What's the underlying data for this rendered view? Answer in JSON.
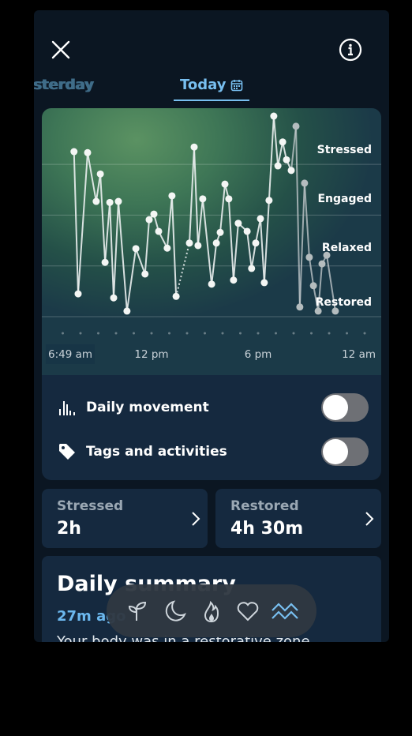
{
  "header": {
    "close_icon": "close-icon",
    "info_icon": "info-icon"
  },
  "tabs": [
    {
      "label": "sterday",
      "full_label": "Yesterday",
      "active": false
    },
    {
      "label": "Today",
      "active": true,
      "icon": "calendar-icon"
    }
  ],
  "colors": {
    "accent": "#78bff0",
    "stat_label": "#9aa7b3",
    "toggle_off": "#6e7075",
    "card": "#15293f",
    "background": "#0b1622"
  },
  "chart_data": {
    "type": "line",
    "title": "",
    "levels": [
      "Restored",
      "Relaxed",
      "Engaged",
      "Stressed"
    ],
    "x_tick_labels": [
      "6:49 am",
      "12 pm",
      "6 pm",
      "12 am"
    ],
    "xlim": [
      "06:49",
      "24:00"
    ],
    "ylim": [
      0,
      4
    ],
    "grid": true,
    "gap_between": [
      "13:23",
      "14:08"
    ],
    "faded_from": "20:08",
    "points": [
      [
        "07:38",
        3.25
      ],
      [
        "07:52",
        0.45
      ],
      [
        "08:24",
        3.23
      ],
      [
        "08:53",
        2.27
      ],
      [
        "09:07",
        2.81
      ],
      [
        "09:23",
        1.07
      ],
      [
        "09:39",
        2.25
      ],
      [
        "09:52",
        0.37
      ],
      [
        "10:08",
        2.27
      ],
      [
        "10:37",
        0.11
      ],
      [
        "11:07",
        1.34
      ],
      [
        "11:38",
        0.84
      ],
      [
        "11:52",
        1.91
      ],
      [
        "12:08",
        2.02
      ],
      [
        "12:24",
        1.68
      ],
      [
        "12:53",
        1.35
      ],
      [
        "13:09",
        2.38
      ],
      [
        "13:23",
        0.4
      ],
      [
        "14:08",
        1.45
      ],
      [
        "14:24",
        3.34
      ],
      [
        "14:37",
        1.4
      ],
      [
        "14:53",
        2.32
      ],
      [
        "15:23",
        0.64
      ],
      [
        "15:39",
        1.45
      ],
      [
        "15:52",
        1.66
      ],
      [
        "16:08",
        2.61
      ],
      [
        "16:21",
        2.32
      ],
      [
        "16:37",
        0.72
      ],
      [
        "16:53",
        1.84
      ],
      [
        "17:23",
        1.68
      ],
      [
        "17:38",
        0.95
      ],
      [
        "17:52",
        1.45
      ],
      [
        "18:08",
        1.93
      ],
      [
        "18:21",
        0.67
      ],
      [
        "18:37",
        2.29
      ],
      [
        "18:53",
        3.95
      ],
      [
        "19:07",
        2.97
      ],
      [
        "19:23",
        3.44
      ],
      [
        "19:36",
        3.09
      ],
      [
        "19:52",
        2.88
      ],
      [
        "20:08",
        3.75
      ],
      [
        "20:21",
        0.19
      ],
      [
        "20:37",
        2.63
      ],
      [
        "20:53",
        1.17
      ],
      [
        "21:07",
        0.61
      ],
      [
        "21:23",
        0.11
      ],
      [
        "21:36",
        1.04
      ],
      [
        "21:52",
        1.21
      ],
      [
        "22:21",
        0.11
      ]
    ]
  },
  "toggles": [
    {
      "label": "Daily movement",
      "icon": "bar-chart-icon",
      "on": false
    },
    {
      "label": "Tags and activities",
      "icon": "tag-icon",
      "on": false
    }
  ],
  "stats": [
    {
      "label": "Stressed",
      "value": "2h"
    },
    {
      "label": "Restored",
      "value": "4h 30m"
    }
  ],
  "summary": {
    "title": "Daily summary",
    "time": "27m ago",
    "body": "Your body was in a restorative zone"
  },
  "nav": [
    {
      "icon": "sprout-icon",
      "active": false
    },
    {
      "icon": "moon-icon",
      "active": false
    },
    {
      "icon": "flame-icon",
      "active": false
    },
    {
      "icon": "heart-icon",
      "active": false
    },
    {
      "icon": "waves-icon",
      "active": true
    }
  ]
}
